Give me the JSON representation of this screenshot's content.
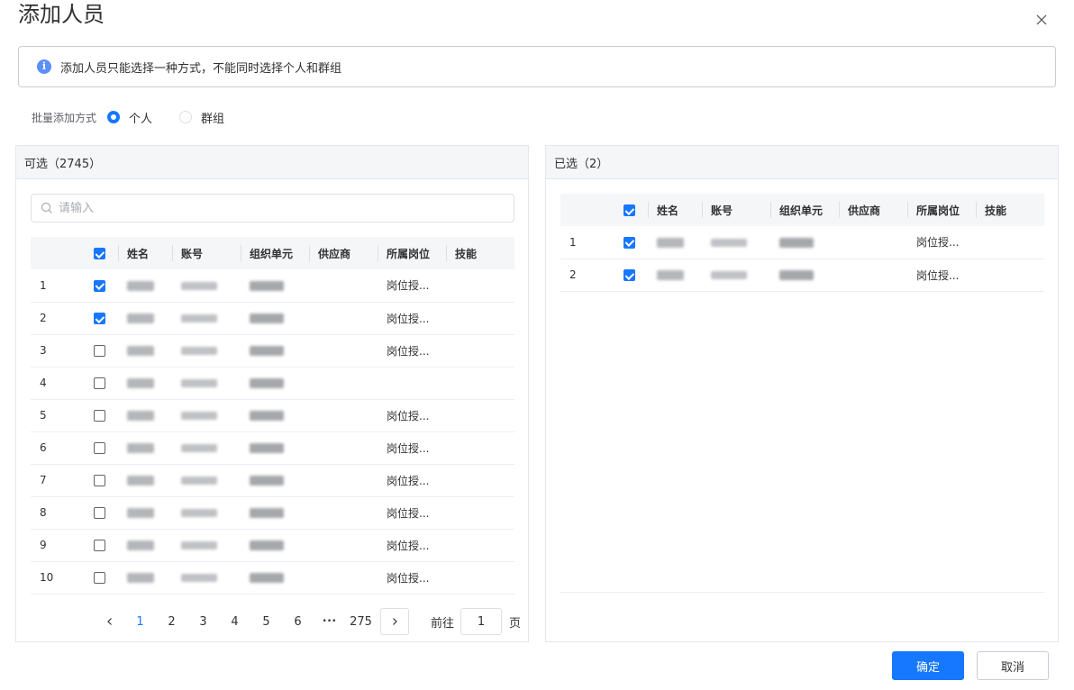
{
  "dialog": {
    "title": "添加人员",
    "info_text": "添加人员只能选择一种方式，不能同时选择个人和群组"
  },
  "mode": {
    "label": "批量添加方式",
    "options": [
      {
        "label": "个人",
        "selected": true
      },
      {
        "label": "群组",
        "selected": false
      }
    ]
  },
  "left_panel": {
    "title": "可选（2745）",
    "search_placeholder": "请输入",
    "columns": [
      "姓名",
      "账号",
      "组织单元",
      "供应商",
      "所属岗位",
      "技能"
    ],
    "rows": [
      {
        "index": "1",
        "checked": true,
        "position": "岗位授..."
      },
      {
        "index": "2",
        "checked": true,
        "position": "岗位授..."
      },
      {
        "index": "3",
        "checked": false,
        "position": "岗位授..."
      },
      {
        "index": "4",
        "checked": false,
        "position": ""
      },
      {
        "index": "5",
        "checked": false,
        "position": "岗位授..."
      },
      {
        "index": "6",
        "checked": false,
        "position": "岗位授..."
      },
      {
        "index": "7",
        "checked": false,
        "position": "岗位授..."
      },
      {
        "index": "8",
        "checked": false,
        "position": "岗位授..."
      },
      {
        "index": "9",
        "checked": false,
        "position": "岗位授..."
      },
      {
        "index": "10",
        "checked": false,
        "position": "岗位授..."
      }
    ],
    "pagination": {
      "pages": [
        "1",
        "2",
        "3",
        "4",
        "5",
        "6"
      ],
      "current": "1",
      "ellipsis": "•••",
      "last_page": "275",
      "goto_label": "前往",
      "goto_value": "1",
      "goto_suffix": "页"
    }
  },
  "right_panel": {
    "title": "已选（2）",
    "columns": [
      "姓名",
      "账号",
      "组织单元",
      "供应商",
      "所属岗位",
      "技能"
    ],
    "rows": [
      {
        "index": "1",
        "checked": true,
        "position": "岗位授..."
      },
      {
        "index": "2",
        "checked": true,
        "position": "岗位授..."
      }
    ]
  },
  "buttons": {
    "confirm": "确定",
    "cancel": "取消"
  },
  "colors": {
    "accent": "#1677ff",
    "info_icon": "#5b8ff9"
  },
  "icons": [
    "close-icon",
    "info-icon",
    "search-icon",
    "chevron-left-icon",
    "chevron-right-icon",
    "checkbox-icon"
  ]
}
